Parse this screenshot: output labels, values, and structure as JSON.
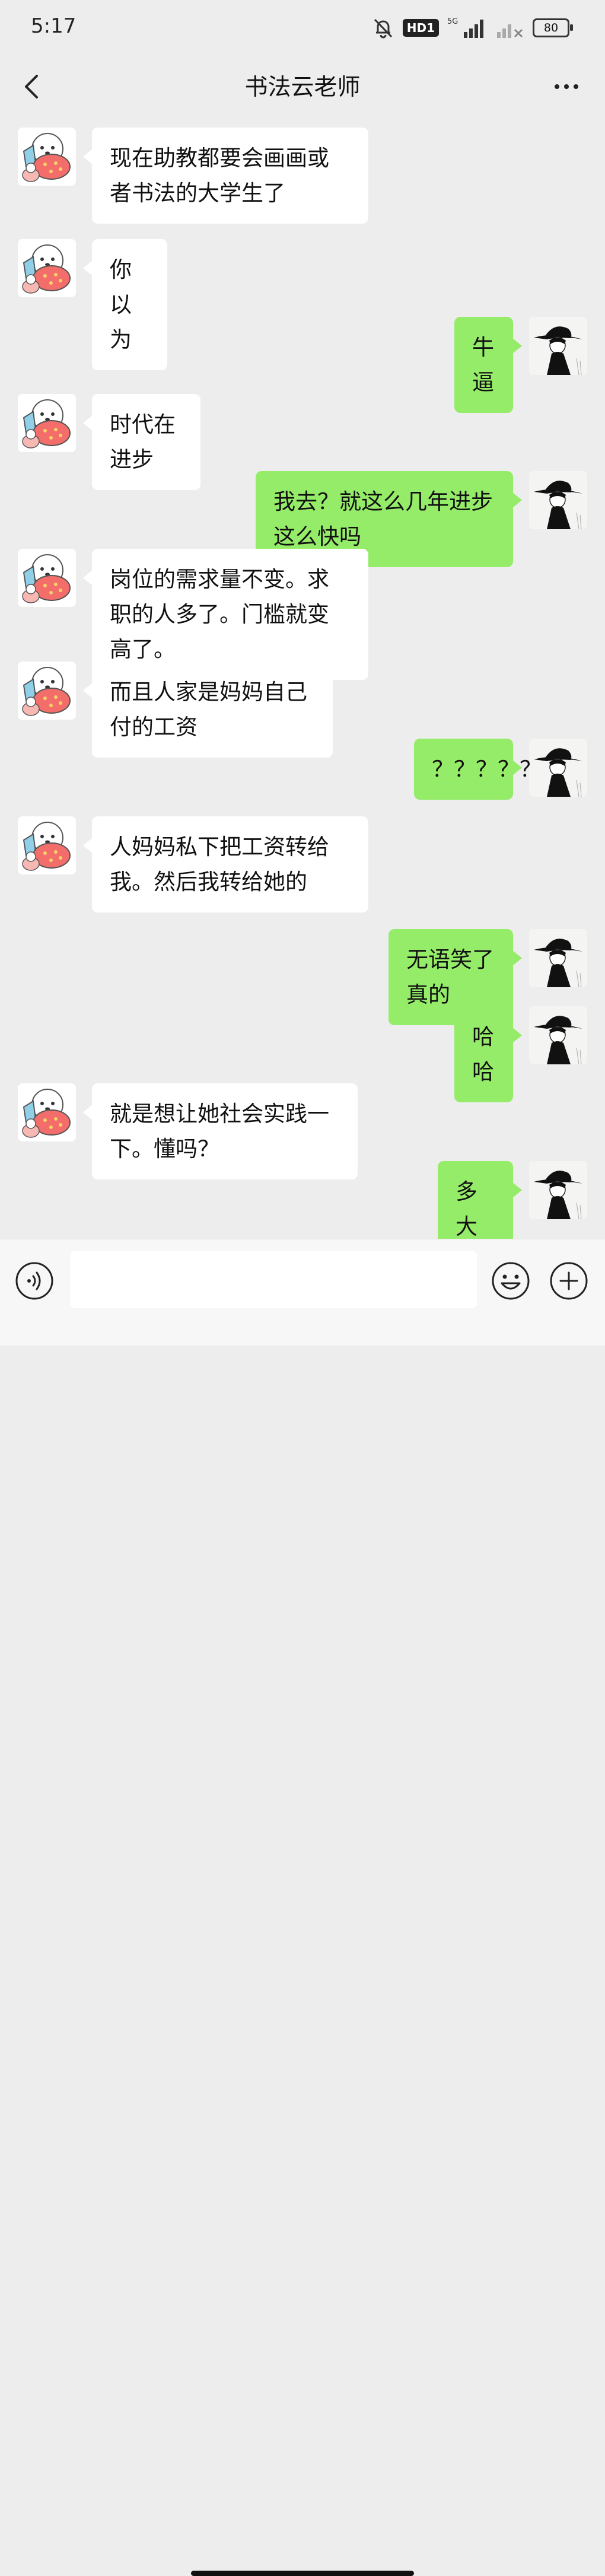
{
  "status_bar": {
    "time": "5:17",
    "hd_label": "HD1",
    "network": "5G",
    "battery": "80"
  },
  "header": {
    "title": "书法云老师"
  },
  "messages": [
    {
      "side": "left",
      "text": "现在助教都要会画画或者书法的大学生了"
    },
    {
      "side": "left",
      "text": "你以为"
    },
    {
      "side": "right",
      "text": "牛逼"
    },
    {
      "side": "left",
      "text": "时代在进步"
    },
    {
      "side": "right",
      "text": "我去？就这么几年进步这么快吗"
    },
    {
      "side": "left",
      "text": "岗位的需求量不变。求职的人多了。门槛就变高了。"
    },
    {
      "side": "left",
      "text": "而且人家是妈妈自己付的工资"
    },
    {
      "side": "right",
      "text": "？？？？？"
    },
    {
      "side": "left",
      "text": "人妈妈私下把工资转给我。然后我转给她的"
    },
    {
      "side": "right",
      "text": "无语笑了真的"
    },
    {
      "side": "right",
      "text": "哈哈"
    },
    {
      "side": "left",
      "text": "就是想让她社会实践一下。懂吗？"
    },
    {
      "side": "right",
      "text": "多大她"
    }
  ],
  "input_bar": {
    "placeholder": ""
  },
  "icons": {
    "back": "chevron-left-icon",
    "more": "more-dots-icon",
    "voice": "voice-icon",
    "emoji": "emoji-icon",
    "plus": "plus-icon",
    "contact_avatar": "cartoon-avatar",
    "self_avatar": "silhouette-hat-avatar"
  },
  "colors": {
    "background": "#ededed",
    "sent_bubble": "#95ec69",
    "received_bubble": "#ffffff"
  }
}
